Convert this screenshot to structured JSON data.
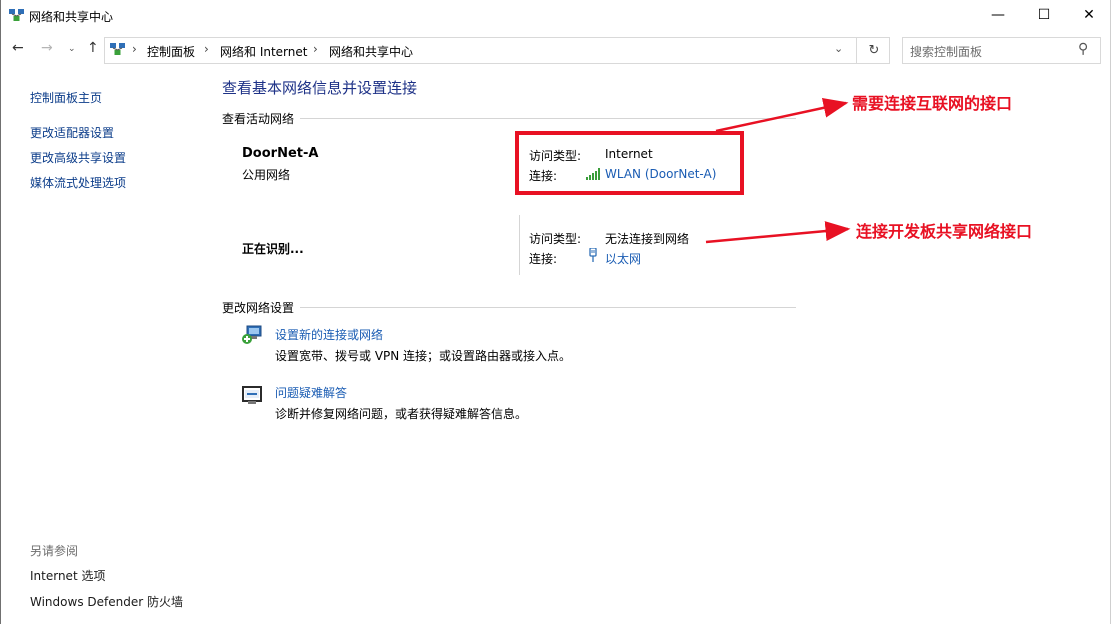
{
  "window": {
    "title": "网络和共享中心",
    "minimize_glyph": "—",
    "maximize_glyph": "☐",
    "close_glyph": "✕"
  },
  "nav": {
    "back_glyph": "←",
    "forward_glyph": "→",
    "recent_glyph": "⌄",
    "up_glyph": "↑",
    "breadcrumb": [
      "控制面板",
      "网络和 Internet",
      "网络和共享中心"
    ],
    "separator": "›",
    "dropdown_glyph": "⌄",
    "refresh_glyph": "↻"
  },
  "search": {
    "placeholder": "搜索控制面板",
    "icon": "search-icon",
    "glyph": "⚲"
  },
  "sidebar": {
    "home": "控制面板主页",
    "links": [
      "更改适配器设置",
      "更改高级共享设置",
      "媒体流式处理选项"
    ],
    "see_also_label": "另请参阅",
    "see_also": [
      "Internet 选项",
      "Windows Defender 防火墙"
    ]
  },
  "main": {
    "heading": "查看基本网络信息并设置连接",
    "active_networks_label": "查看活动网络",
    "network1": {
      "name": "DoorNet-A",
      "category": "公用网络",
      "access_type_label": "访问类型:",
      "access_type": "Internet",
      "connection_label": "连接:",
      "connection": "WLAN (DoorNet-A)"
    },
    "network2": {
      "name": "正在识别...",
      "access_type_label": "访问类型:",
      "access_type": "无法连接到网络",
      "connection_label": "连接:",
      "connection": "以太网"
    },
    "change_settings_label": "更改网络设置",
    "tasks": [
      {
        "title": "设置新的连接或网络",
        "desc": "设置宽带、拨号或 VPN 连接；或设置路由器或接入点。"
      },
      {
        "title": "问题疑难解答",
        "desc": "诊断并修复网络问题，或者获得疑难解答信息。"
      }
    ]
  },
  "annotations": {
    "note1": "需要连接互联网的接口",
    "note2": "连接开发板共享网络接口",
    "color": "#e81123"
  },
  "colors": {
    "link": "#1a5cb3",
    "heading": "#1e3287",
    "annotation": "#e81123"
  }
}
